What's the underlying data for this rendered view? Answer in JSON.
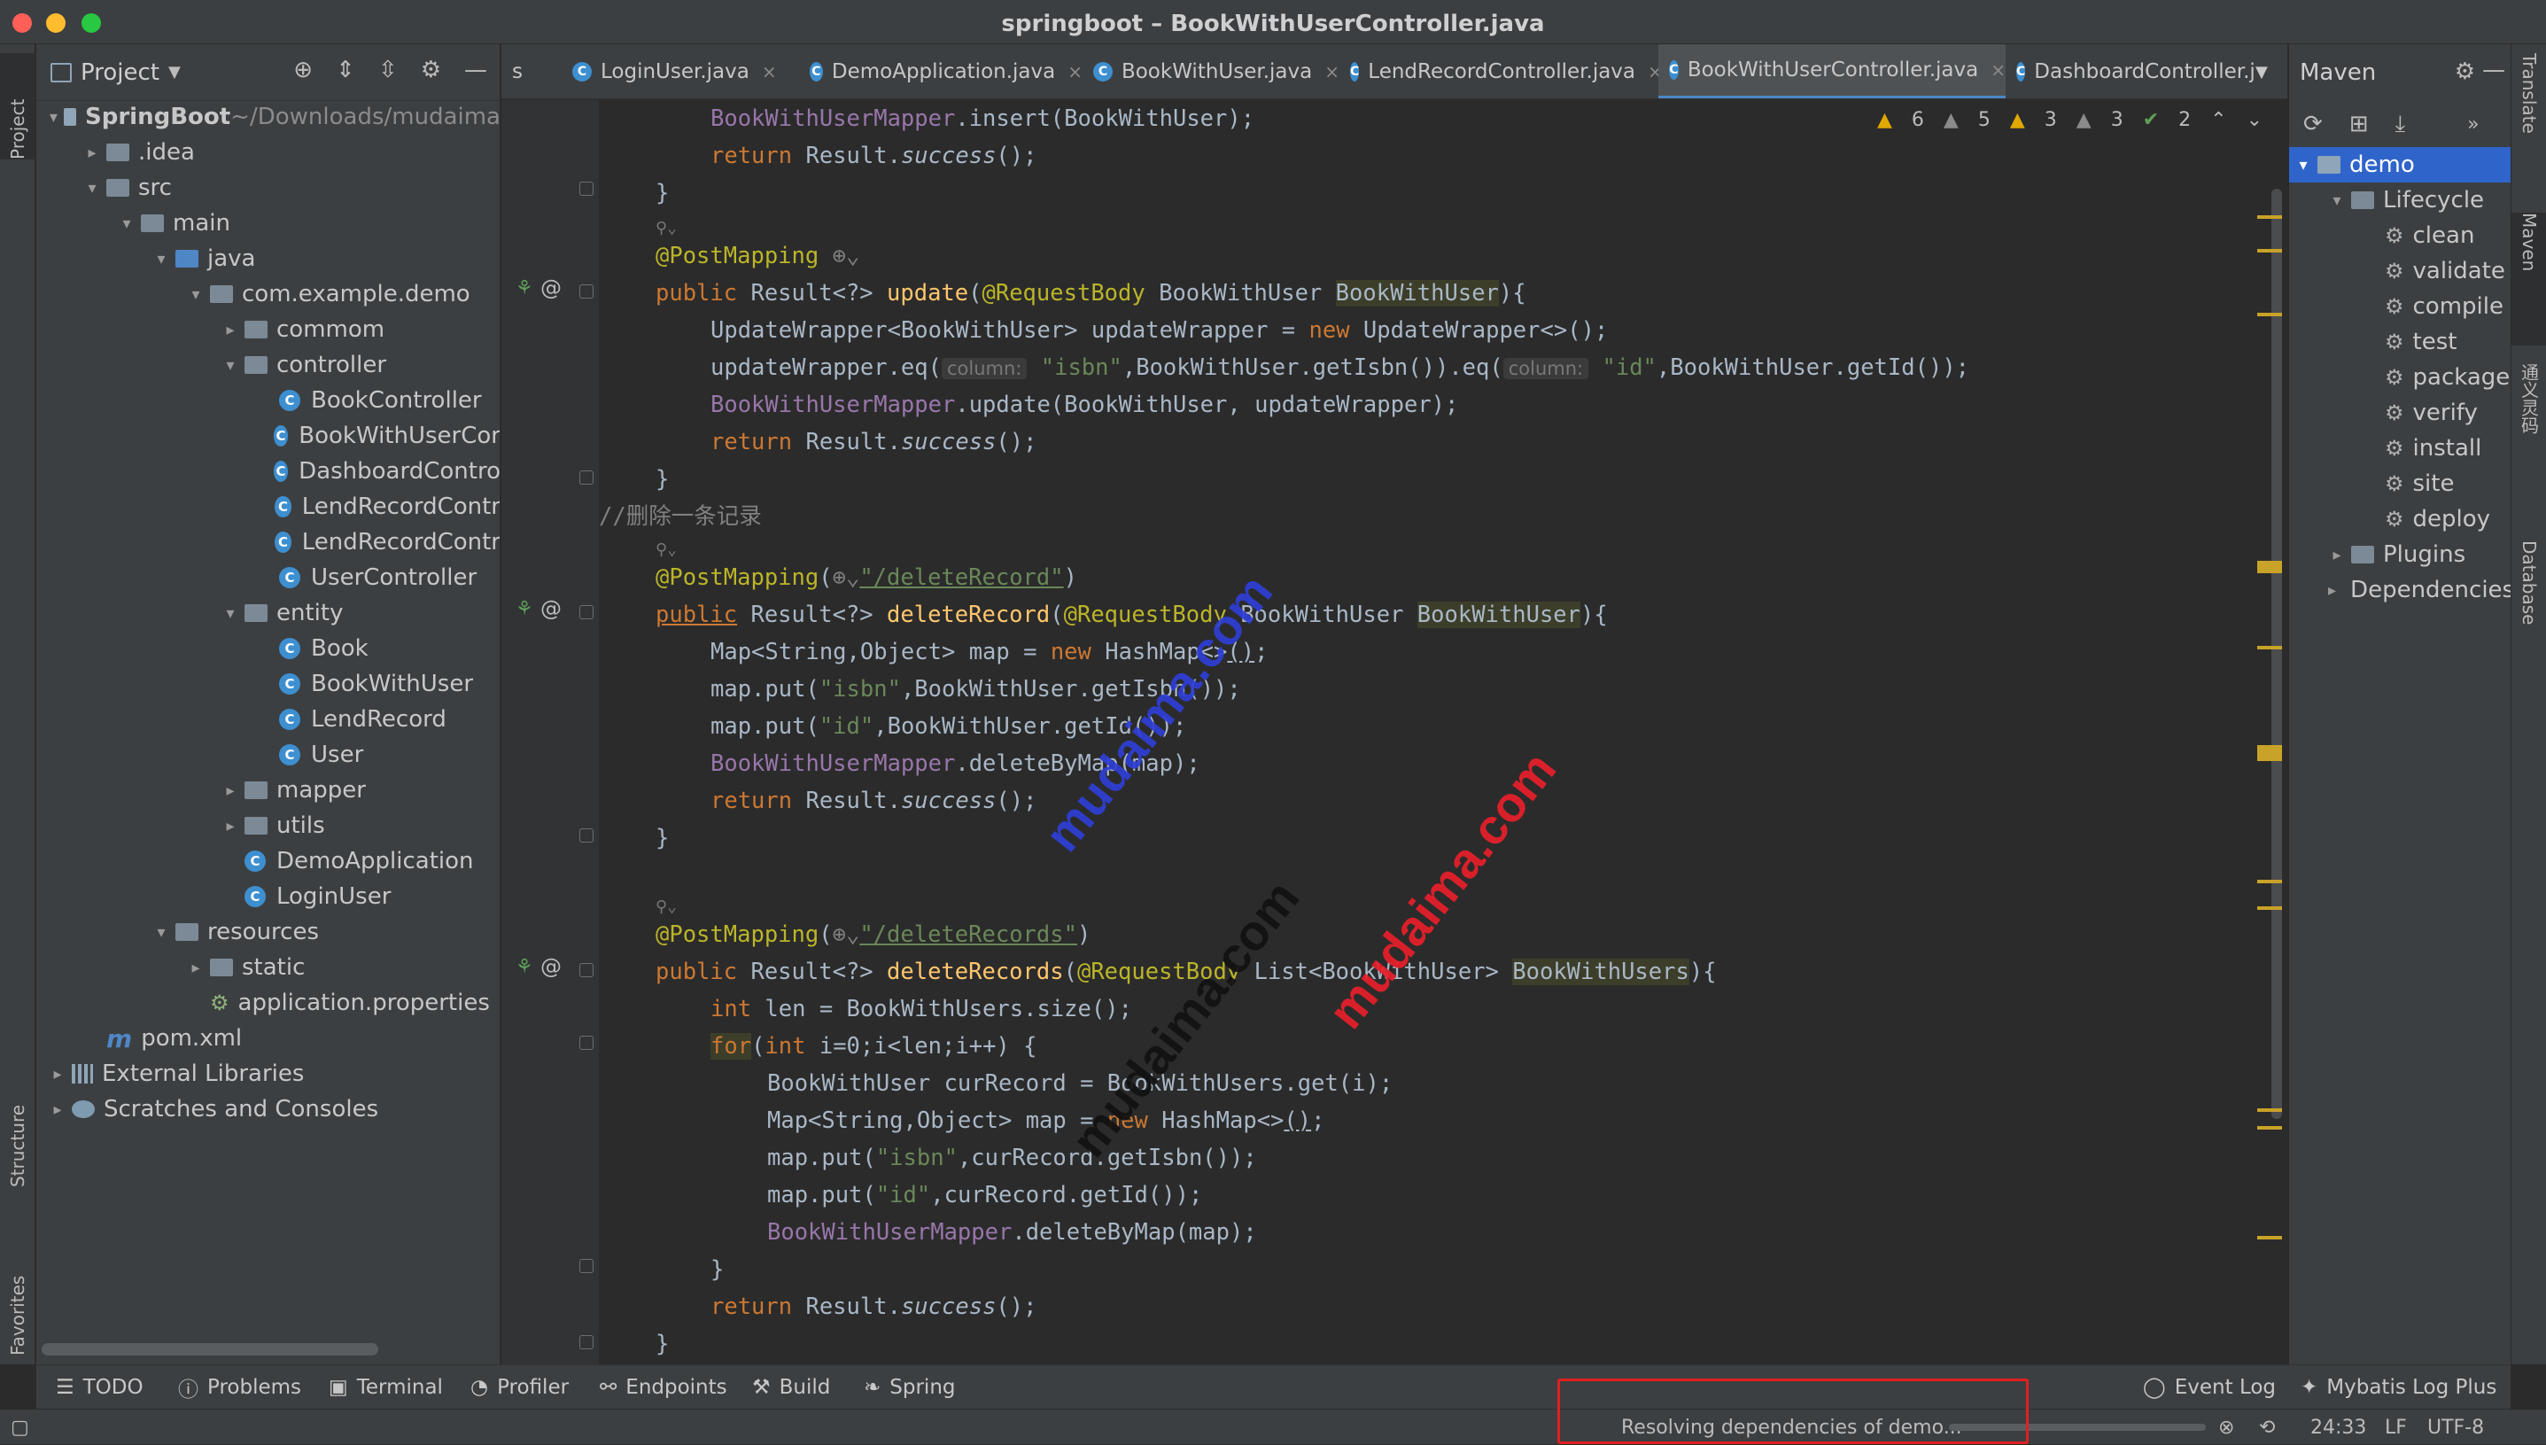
{
  "window": {
    "title": "springboot – BookWithUserController.java"
  },
  "left_strip": {
    "project": "Project",
    "structure": "Structure",
    "favorites": "Favorites"
  },
  "right_strip": {
    "translate": "Translate",
    "maven": "Maven",
    "plugin": "通义灵码",
    "database": "Database"
  },
  "project": {
    "header": "Project",
    "tree": [
      {
        "label": "SpringBoot",
        "suffix": " ~/Downloads/mudaima",
        "indent": 0,
        "arrow": "▾",
        "icon": "module"
      },
      {
        "label": ".idea",
        "indent": 1,
        "arrow": "▸",
        "icon": "folder"
      },
      {
        "label": "src",
        "indent": 1,
        "arrow": "▾",
        "icon": "folder"
      },
      {
        "label": "main",
        "indent": 2,
        "arrow": "▾",
        "icon": "folder"
      },
      {
        "label": "java",
        "indent": 3,
        "arrow": "▾",
        "icon": "folder-blue"
      },
      {
        "label": "com.example.demo",
        "indent": 4,
        "arrow": "▾",
        "icon": "folder"
      },
      {
        "label": "commom",
        "indent": 5,
        "arrow": "▸",
        "icon": "folder"
      },
      {
        "label": "controller",
        "indent": 5,
        "arrow": "▾",
        "icon": "folder"
      },
      {
        "label": "BookController",
        "indent": 6,
        "arrow": "",
        "icon": "class"
      },
      {
        "label": "BookWithUserCor",
        "indent": 6,
        "arrow": "",
        "icon": "class"
      },
      {
        "label": "DashboardContro",
        "indent": 6,
        "arrow": "",
        "icon": "class"
      },
      {
        "label": "LendRecordContr",
        "indent": 6,
        "arrow": "",
        "icon": "class"
      },
      {
        "label": "LendRecordContr",
        "indent": 6,
        "arrow": "",
        "icon": "class"
      },
      {
        "label": "UserController",
        "indent": 6,
        "arrow": "",
        "icon": "class"
      },
      {
        "label": "entity",
        "indent": 5,
        "arrow": "▾",
        "icon": "folder"
      },
      {
        "label": "Book",
        "indent": 6,
        "arrow": "",
        "icon": "class"
      },
      {
        "label": "BookWithUser",
        "indent": 6,
        "arrow": "",
        "icon": "class"
      },
      {
        "label": "LendRecord",
        "indent": 6,
        "arrow": "",
        "icon": "class"
      },
      {
        "label": "User",
        "indent": 6,
        "arrow": "",
        "icon": "class"
      },
      {
        "label": "mapper",
        "indent": 5,
        "arrow": "▸",
        "icon": "folder"
      },
      {
        "label": "utils",
        "indent": 5,
        "arrow": "▸",
        "icon": "folder"
      },
      {
        "label": "DemoApplication",
        "indent": 5,
        "arrow": "",
        "icon": "class"
      },
      {
        "label": "LoginUser",
        "indent": 5,
        "arrow": "",
        "icon": "class"
      },
      {
        "label": "resources",
        "indent": 3,
        "arrow": "▾",
        "icon": "folder"
      },
      {
        "label": "static",
        "indent": 4,
        "arrow": "▸",
        "icon": "folder"
      },
      {
        "label": "application.properties",
        "indent": 4,
        "arrow": "",
        "icon": "props"
      },
      {
        "label": "pom.xml",
        "indent": 1,
        "arrow": "",
        "icon": "maven"
      },
      {
        "label": "External Libraries",
        "indent": 0,
        "arrow": "▸",
        "icon": "lib"
      },
      {
        "label": "Scratches and Consoles",
        "indent": 0,
        "arrow": "▸",
        "icon": "scratch"
      }
    ]
  },
  "tabs": [
    {
      "label": "s",
      "close": ""
    },
    {
      "label": "LoginUser.java",
      "close": "×"
    },
    {
      "label": "DemoApplication.java",
      "close": "×"
    },
    {
      "label": "BookWithUser.java",
      "close": "×"
    },
    {
      "label": "LendRecordController.java",
      "close": "×"
    },
    {
      "label": "BookWithUserController.java",
      "close": "×"
    },
    {
      "label": "DashboardController.j",
      "close": ""
    }
  ],
  "inspections": {
    "w1": "6",
    "w2": "5",
    "w3": "3",
    "w4": "3",
    "ok": "2"
  },
  "code": {
    "l1a": "BookWithUserMapper",
    "l1b": ".insert(BookWithUser);",
    "ret": "return",
    "res": " Result.",
    "succ": "success",
    "end": "();",
    "brace": "}",
    "post": "@PostMapping",
    "pub": "public",
    "l4b": " Result<?> ",
    "upd": "update",
    "rb": "@RequestBody",
    "bwu": " BookWithUser ",
    "bwuv": "BookWithUser",
    "ob": "){",
    "l5a": "UpdateWrapper<BookWithUser> updateWrapper = ",
    "nw": "new",
    "l5b": " UpdateWrapper<>();",
    "l6a": "updateWrapper.eq(",
    "col": "column:",
    "isbn": "\"isbn\"",
    "l6b": ",BookWithUser.getIsbn()).eq(",
    "id": "\"id\"",
    "l6c": ",BookWithUser.getId());",
    "l7b": ".update(BookWithUser, updateWrapper);",
    "comment": "//删除一条记录",
    "delpath": "\"/deleteRecord\"",
    "delrec": "deleteRecord",
    "l13a": "Map<String,Object> map = ",
    "l13b": " HashMap<>",
    "l14a": "map.put(",
    "l14b": ",BookWithUser.getIsbn());",
    "l15b": ",BookWithUser.getId());",
    "l16b": ".deleteByMap(map);",
    "delspath": "\"/deleteRecords\"",
    "delrecs": "deleteRecords",
    "l20a": "List<BookWithUser> ",
    "bwus": "BookWithUsers",
    "intk": "int",
    "l21b": " len = BookWithUsers.size();",
    "fork": "for",
    "l22b": "(",
    "l22c": " i=0;i<len;i++) {",
    "l23": "BookWithUser curRecord = BookWithUsers.get(i);",
    "l25b": ",curRecord.getIsbn());",
    "l26b": ",curRecord.getId());"
  },
  "watermarks": [
    "mudaima.com",
    "mudaima.com",
    "mudaima.com"
  ],
  "maven": {
    "header": "Maven",
    "tree": [
      {
        "label": "demo",
        "indent": 0,
        "arrow": "▾",
        "sel": true,
        "icon": "module"
      },
      {
        "label": "Lifecycle",
        "indent": 1,
        "arrow": "▾",
        "icon": "folder"
      },
      {
        "label": "clean",
        "indent": 2,
        "arrow": "",
        "icon": "gear"
      },
      {
        "label": "validate",
        "indent": 2,
        "arrow": "",
        "icon": "gear"
      },
      {
        "label": "compile",
        "indent": 2,
        "arrow": "",
        "icon": "gear"
      },
      {
        "label": "test",
        "indent": 2,
        "arrow": "",
        "icon": "gear"
      },
      {
        "label": "package",
        "indent": 2,
        "arrow": "",
        "icon": "gear"
      },
      {
        "label": "verify",
        "indent": 2,
        "arrow": "",
        "icon": "gear"
      },
      {
        "label": "install",
        "indent": 2,
        "arrow": "",
        "icon": "gear"
      },
      {
        "label": "site",
        "indent": 2,
        "arrow": "",
        "icon": "gear"
      },
      {
        "label": "deploy",
        "indent": 2,
        "arrow": "",
        "icon": "gear"
      },
      {
        "label": "Plugins",
        "indent": 1,
        "arrow": "▸",
        "icon": "folder"
      },
      {
        "label": "Dependencies",
        "indent": 1,
        "arrow": "▸",
        "icon": "lib"
      }
    ]
  },
  "toolwindows": {
    "todo": "TODO",
    "problems": "Problems",
    "terminal": "Terminal",
    "profiler": "Profiler",
    "endpoints": "Endpoints",
    "build": "Build",
    "spring": "Spring",
    "eventlog": "Event Log",
    "mybatis": "Mybatis Log Plus"
  },
  "status": {
    "resolving": "Resolving dependencies of demo...",
    "position": "24:33",
    "lf": "LF",
    "encoding": "UTF-8"
  }
}
